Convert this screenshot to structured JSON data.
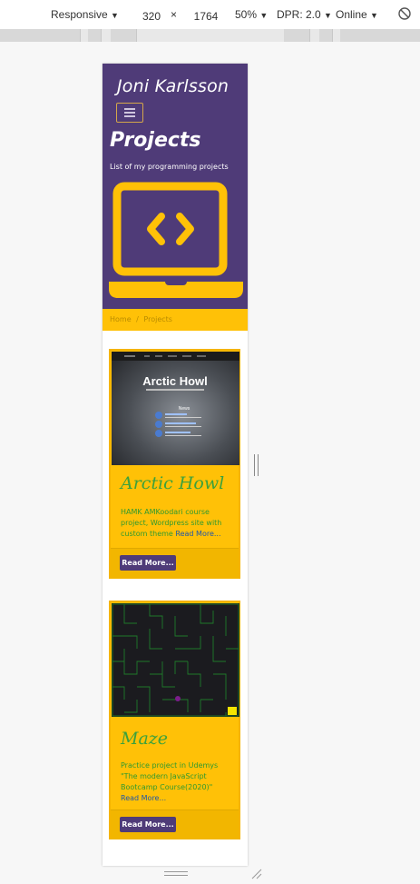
{
  "devtools": {
    "device_mode": "Responsive",
    "width": "320",
    "times": "×",
    "height": "1764",
    "zoom": "50%",
    "dpr": "DPR: 2.0",
    "network": "Online"
  },
  "site": {
    "title": "Joni Karlsson",
    "heading": "Projects",
    "subheading": "List of my programming projects",
    "breadcrumb_home": "Home",
    "breadcrumb_sep": "/",
    "breadcrumb_current": "Projects"
  },
  "projects": [
    {
      "title": "Arctic Howl",
      "description": "HAMK AMKoodari course project, Wordpress site with custom theme",
      "read_more_link": "Read More...",
      "button_label": "Read More...",
      "thumb_heading": "Arctic Howl",
      "thumb_news": "News"
    },
    {
      "title": "Maze",
      "description": "Practice project in Udemys \"The modern JavaScript Bootcamp Course(2020)\"",
      "read_more_link": "Read More...",
      "button_label": "Read More..."
    }
  ],
  "colors": {
    "brand_purple": "#4f3b78",
    "accent_yellow": "#ffc107",
    "title_green": "#3ca13c"
  }
}
